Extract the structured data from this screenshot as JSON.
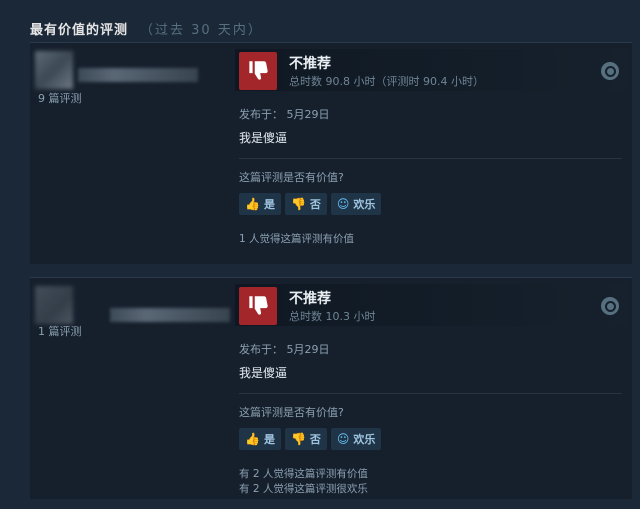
{
  "section": {
    "title": "最有价值的评测",
    "period": "（过去 30 天内）"
  },
  "reviews": [
    {
      "review_count": "9 篇评测",
      "recommendation": "不推荐",
      "hours": "总时数 90.8 小时（评测时 90.4 小时）",
      "posted": "发布于：  5月29日",
      "content": "我是傻逼",
      "helpful_question": "这篇评测是否有价值?",
      "buttons": {
        "yes": "是",
        "no": "否",
        "funny": "欢乐"
      },
      "helpful_count": "1 人觉得这篇评测有价值",
      "funny_count": ""
    },
    {
      "review_count": "1 篇评测",
      "recommendation": "不推荐",
      "hours": "总时数 10.3 小时",
      "posted": "发布于：  5月29日",
      "content": "我是傻逼",
      "helpful_question": "这篇评测是否有价值?",
      "buttons": {
        "yes": "是",
        "no": "否",
        "funny": "欢乐"
      },
      "helpful_count": "有 2 人觉得这篇评测有价值",
      "funny_count": "有 2 人觉得这篇评测很欢乐"
    }
  ],
  "colors": {
    "background": "#1b2838",
    "thumb_down": "#a3262a",
    "button_accent": "#67c1f5"
  },
  "icons": {
    "recommendation": "thumbs-down-icon",
    "platform": "steam-icon",
    "vote_yes": "thumbs-up-icon",
    "vote_no": "thumbs-down-icon",
    "vote_funny": "smiley-icon"
  }
}
